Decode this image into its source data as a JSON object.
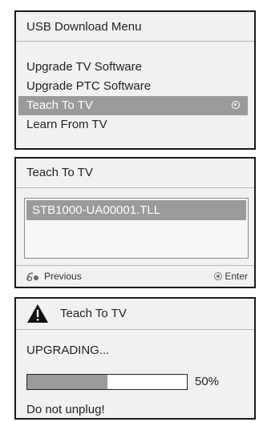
{
  "usb_menu": {
    "title": "USB Download Menu",
    "items": [
      {
        "label": "Upgrade TV Software",
        "selected": false
      },
      {
        "label": "Upgrade PTC Software",
        "selected": false
      },
      {
        "label": "Teach To TV",
        "selected": true
      },
      {
        "label": "Learn From TV",
        "selected": false
      }
    ]
  },
  "teach_dialog": {
    "title": "Teach To TV",
    "files": [
      "STB1000-UA00001.TLL"
    ],
    "footer": {
      "previous_label": "Previous",
      "enter_label": "Enter"
    }
  },
  "progress_dialog": {
    "title": "Teach To TV",
    "status": "UPGRADING...",
    "progress_percent": 50,
    "progress_label": "50%",
    "note": "Do not unplug!"
  },
  "colors": {
    "highlight": "#9a9a9a",
    "panel_bg": "#f1f1f1",
    "border": "#1a1a1a"
  }
}
